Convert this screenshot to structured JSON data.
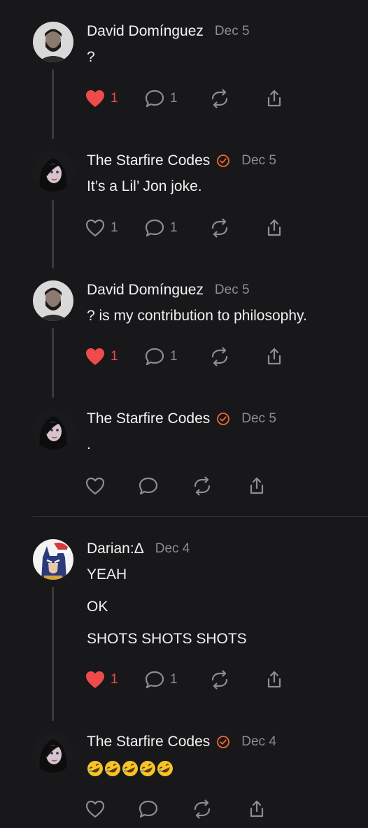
{
  "colors": {
    "background": "#18181a",
    "text": "#f2f2f2",
    "muted": "#8d8d92",
    "like_active": "#ef4b4b",
    "verified": "#f26a2e"
  },
  "posts": [
    {
      "author": "David Domínguez",
      "date": "Dec 5",
      "lines": [
        "?"
      ],
      "liked": true,
      "like_count": "1",
      "reply_count": "1",
      "verified": false,
      "avatar": "man-with-beard-avatar"
    },
    {
      "author": "The Starfire Codes",
      "date": "Dec 5",
      "lines": [
        "It’s a Lil’ Jon joke."
      ],
      "liked": false,
      "like_count": "1",
      "reply_count": "1",
      "verified": true,
      "avatar": "woman-dark-hair-avatar"
    },
    {
      "author": "David Domínguez",
      "date": "Dec 5",
      "lines": [
        "? is my contribution to philosophy."
      ],
      "liked": true,
      "like_count": "1",
      "reply_count": "1",
      "verified": false,
      "avatar": "man-with-beard-avatar"
    },
    {
      "author": "The Starfire Codes",
      "date": "Dec 5",
      "lines": [
        "."
      ],
      "liked": false,
      "like_count": "",
      "reply_count": "",
      "verified": true,
      "avatar": "woman-dark-hair-avatar"
    },
    {
      "author": "Darian:Δ",
      "date": "Dec 4",
      "lines": [
        "YEAH",
        "OK",
        "SHOTS SHOTS SHOTS"
      ],
      "liked": true,
      "like_count": "1",
      "reply_count": "1",
      "verified": false,
      "avatar": "batman-santa-hat-avatar"
    },
    {
      "author": "The Starfire Codes",
      "date": "Dec 4",
      "emojis": [
        "🤣",
        "🤣",
        "🤣",
        "🤣",
        "🤣"
      ],
      "liked": false,
      "like_count": "",
      "reply_count": "",
      "verified": true,
      "avatar": "woman-dark-hair-avatar"
    }
  ]
}
